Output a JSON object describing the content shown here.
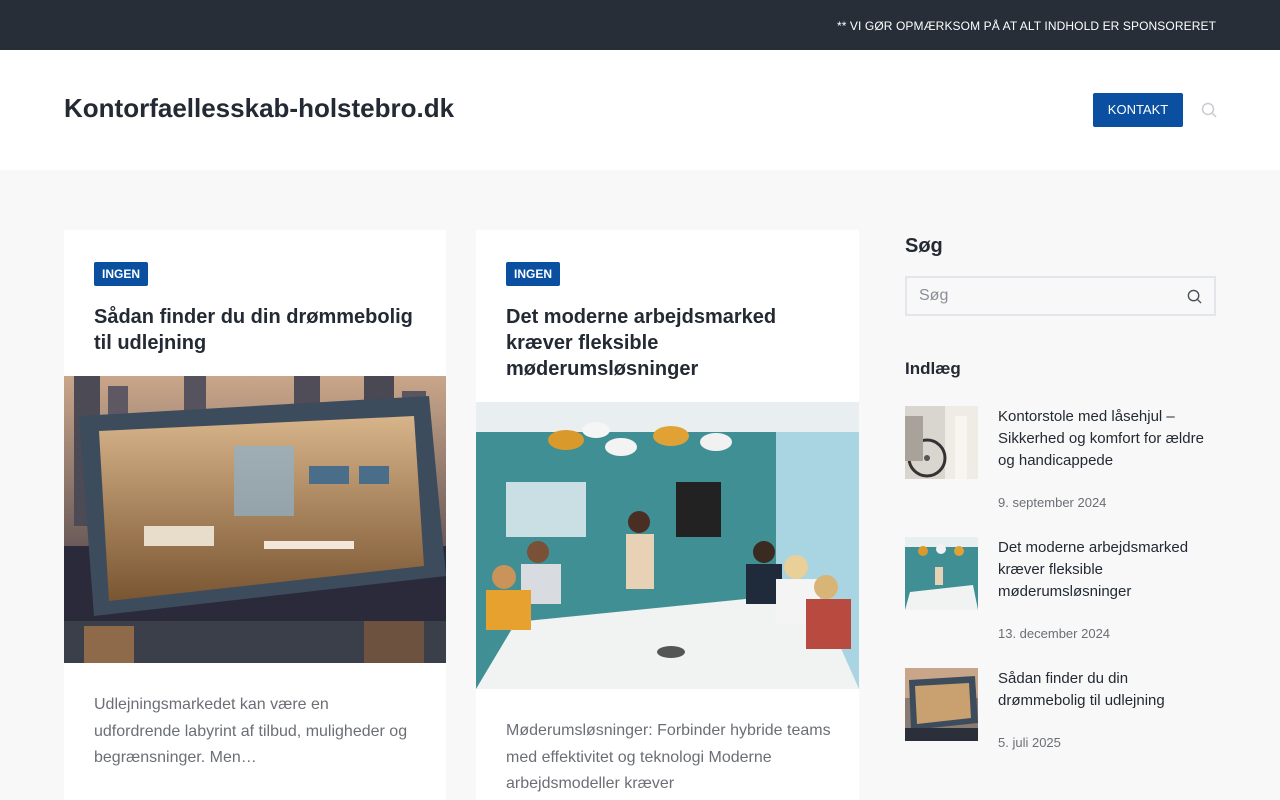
{
  "topbar": {
    "notice": "** VI GØR OPMÆRKSOM PÅ AT ALT INDHOLD ER SPONSORERET"
  },
  "header": {
    "site_title": "Kontorfaellesskab-holstebro.dk",
    "contact_label": "KONTAKT",
    "search_icon": "search-icon"
  },
  "posts_grid": [
    {
      "category": "INGEN",
      "title": "Sådan finder du din drømmebolig til udlejning",
      "excerpt": "Udlejningsmarkedet kan være en udfordrende labyrint af tilbud, muligheder og begrænsninger. Men…"
    },
    {
      "category": "INGEN",
      "title": "Det moderne arbejdsmarked kræver fleksible møderumsløsninger",
      "excerpt": "Møderumsløsninger: Forbinder hybride teams med effektivitet og teknologi Moderne arbejdsmodeller kræver"
    }
  ],
  "sidebar": {
    "search_heading": "Søg",
    "search_placeholder": "Søg",
    "posts_heading": "Indlæg",
    "recent_posts": [
      {
        "title": "Kontorstole med låsehjul – Sikkerhed og komfort for ældre og handicappede",
        "date": "9. september 2024"
      },
      {
        "title": "Det moderne arbejdsmarked kræver fleksible møderumsløsninger",
        "date": "13. december 2024"
      },
      {
        "title": "Sådan finder du din drømmebolig til udlejning",
        "date": "5. juli 2025"
      }
    ]
  },
  "colors": {
    "accent": "#0a4fa0",
    "topbar": "#272e38",
    "background": "#f8f8f8"
  }
}
